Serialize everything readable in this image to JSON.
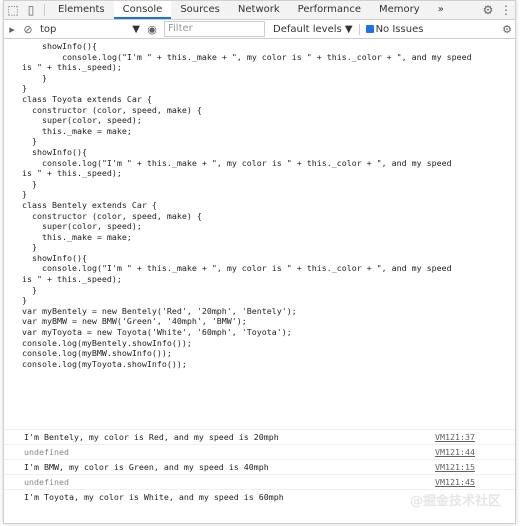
{
  "tabs": {
    "elements": "Elements",
    "console": "Console",
    "sources": "Sources",
    "network": "Network",
    "performance": "Performance",
    "memory": "Memory",
    "more": "»"
  },
  "toolbar": {
    "context": "top",
    "filter_placeholder": "Filter",
    "levels": "Default levels ▼",
    "issues": "No Issues"
  },
  "code_lines": [
    "showInfo(){",
    "    console.log(\"I'm \" + this._make + \", my color is \" + this._color + \", and my speed",
    "is \" + this._speed);",
    "}",
    "}",
    "",
    "class Toyota extends Car {",
    "    constructor (color, speed, make) {",
    "        super(color, speed);",
    "        this._make = make;",
    "    }",
    "",
    "    showInfo(){",
    "        console.log(\"I'm \" + this._make + \", my color is \" + this._color + \", and my speed",
    "is \" + this._speed);",
    "    }",
    "}",
    "",
    "class Bentely extends Car {",
    "    constructor (color, speed, make) {",
    "        super(color, speed);",
    "        this._make = make;",
    "    }",
    "",
    "    showInfo(){",
    "        console.log(\"I'm \" + this._make + \", my color is \" + this._color + \", and my speed",
    "is \" + this._speed);",
    "    }",
    "}",
    "",
    "var myBentely = new Bentely('Red', '20mph', 'Bentely');",
    "var myBMW = new BMW('Green', '40mph', 'BMW');",
    "var myToyota = new Toyota('White', '60mph', 'Toyota');",
    "console.log(myBentely.showInfo());",
    "console.log(myBMW.showInfo());",
    "console.log(myToyota.showInfo());"
  ],
  "outputs": [
    {
      "text": "I'm Bentely, my color is Red, and my speed is 20mph",
      "source": "VM121:37"
    },
    {
      "text": "undefined",
      "source": "VM121:44"
    },
    {
      "text": "I'm BMW, my color is Green, and my speed is 40mph",
      "source": "VM121:15"
    },
    {
      "text": "undefined",
      "source": "VM121:45"
    },
    {
      "text": "I'm Toyota, my color is White, and my speed is 60mph",
      "source": ""
    }
  ],
  "watermark": "@掘金技术社区"
}
